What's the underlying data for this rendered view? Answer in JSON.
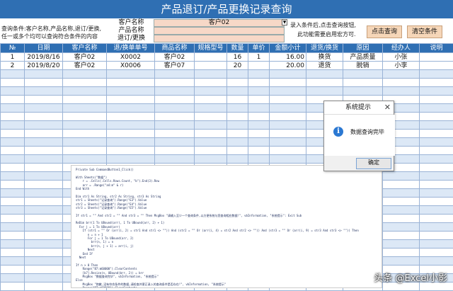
{
  "title": "产品退订/产品更换记录查询",
  "query": {
    "hint_line1": "查询条件:客户名称,产品名称,退订/更换,",
    "hint_line2": "任一或多个均可以查询符合条件的内容",
    "labels": [
      "客户名称",
      "产品名称",
      "退订/更换"
    ],
    "values": [
      "客户02",
      "",
      ""
    ],
    "hint_right_line1": "录入条件后,点击查询按钮,",
    "hint_right_line2": "此功能需要启用宏方可.",
    "query_button": "点击查询",
    "clear_button": "清空条件"
  },
  "table": {
    "headers": [
      "№",
      "日期",
      "客户名称",
      "退/换单单号",
      "商品名称",
      "规格型号",
      "数量",
      "单价",
      "金额小计",
      "退货/换货",
      "原因",
      "经办人",
      "说明"
    ],
    "rows": [
      [
        "1",
        "2019/8/16",
        "客户02",
        "X0002",
        "客户02",
        "",
        "16",
        "1",
        "16.00",
        "换货",
        "产品质量",
        "小张",
        ""
      ],
      [
        "2",
        "2019/8/20",
        "客户02",
        "X0006",
        "客户07",
        "",
        "20",
        "",
        "20.00",
        "退货",
        "脱销",
        "小李",
        ""
      ]
    ]
  },
  "code_lines": [
    "Private Sub CommandButton1_Click()",
    "",
    "With Sheets(\"数据\")",
    "    r = .Cells(.Cells.Rows.Count, \"b\").End(3).Row",
    "    arr = .Range(\"a4:m\" & r)",
    "End With",
    "",
    "Dim str1 As String, str2 As String, str3 As String",
    "str1 = Sheets(\"记录查询\").Range(\"E3\").Value",
    "str2 = Sheets(\"记录查询\").Range(\"E4\").Value",
    "str3 = Sheets(\"记录查询\").Range(\"E5\").Value",
    "",
    "If str1 = \"\" And str2 = \"\" And str3 = \"\" Then MsgBox \"请输入至少一个查询条件,以方便系统与您查询相应数据!\", vbInformation, \"系统提示\": Exit Sub",
    "",
    "ReDim brr(1 To UBound(arr), 1 To UBound(arr, 2) + 1)",
    "  For j = 1 To UBound(arr)",
    "    If (str1 = \"\" Or (arr(i, 2) = str1 And str1 <> \"\")) And (str2 = \"\" Or (arr(i, 4) = str2 And str2 <> \"\")) And (str3 = \"\" Or (arr(i, 9) = str3 And str3 <> \"\")) Then",
    "       n = n + 1",
    "       For j = 1 To UBound(arr, 2)",
    "         brr(n, 1) = n",
    "         brr(n, j + 1) = arr(i, j)",
    "       Next",
    "    End If",
    "  Next",
    "",
    "If n > 0 Then",
    "    Range(\"B7:m60000\").ClearContents",
    "    [b7].Resize(n, UBound(brr, 2)) = brr",
    "    MsgBox \"数据查询完毕\", vbInformation, \"系统提示\"",
    "Else",
    "    MsgBox \"抱歉,没有符合条件的数据,请检查并更正录入的查询条件是否存在!\", vbInformation, \"系统提示\"",
    "    Range(\"B7:m60000\").ClearContents",
    "End If"
  ],
  "dialog": {
    "title": "系统提示",
    "message": "数据查询完毕",
    "ok_label": "确定"
  },
  "watermark": "头条 @Excel小影"
}
